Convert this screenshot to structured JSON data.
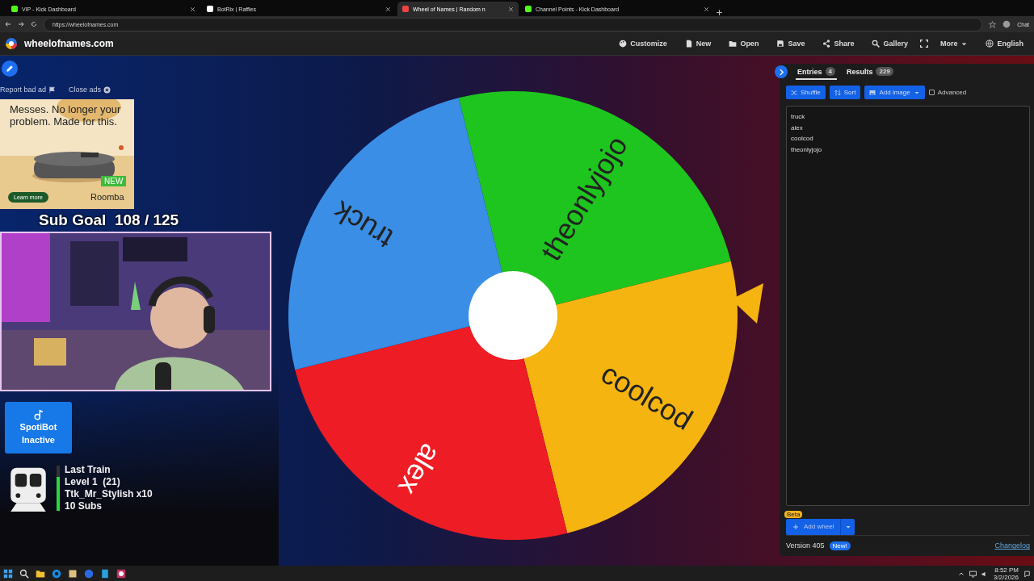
{
  "browser": {
    "tabs": [
      {
        "title": "VIP - Kick Dashboard",
        "selected": false
      },
      {
        "title": "BotRix | Raffles",
        "selected": false
      },
      {
        "title": "Wheel of Names | Random n",
        "selected": true
      },
      {
        "title": "Channel Points - Kick Dashboard",
        "selected": false
      }
    ],
    "address": "https://wheelofnames.com",
    "chat_label": "Chat"
  },
  "site": {
    "name": "wheelofnames.com",
    "nav": [
      "Customize",
      "New",
      "Open",
      "Save",
      "Share",
      "Gallery",
      "More",
      "English"
    ]
  },
  "ads": {
    "report": "Report bad ad",
    "close": "Close ads",
    "headline": "Messes. No longer your problem. Made for this.",
    "badge": "NEW",
    "cta": "Learn more",
    "brand": "Roomba"
  },
  "overlay": {
    "sub_goal": "Sub Goal  108 / 125",
    "spotibot": [
      "SpotiBot",
      "Inactive"
    ],
    "train": {
      "lines": [
        "Last Train",
        "Level 1  (21)",
        "Ttk_Mr_Stylish x10",
        "10 Subs"
      ],
      "level": 0.75
    }
  },
  "wheel": {
    "slices": [
      {
        "label": "theonlyjojo",
        "color": "#1ec51e"
      },
      {
        "label": "coolcod",
        "color": "#f5b40f"
      },
      {
        "label": "alex",
        "color": "#ee1c24"
      },
      {
        "label": "truck",
        "color": "#3a8ee6"
      }
    ]
  },
  "panel": {
    "tabs": [
      {
        "label": "Entries",
        "count": "4",
        "selected": true
      },
      {
        "label": "Results",
        "count": "229",
        "selected": false
      }
    ],
    "buttons": [
      "Shuffle",
      "Sort",
      "Add image"
    ],
    "advanced": {
      "label": "Advanced",
      "checked": false
    },
    "entries": [
      "truck",
      "alex",
      "coolcod",
      "theonlyjojo"
    ],
    "add_wheel": "Add wheel",
    "beta": "Beta",
    "version": "Version 405",
    "new_badge": "New!",
    "changelog": "Changelog"
  },
  "taskbar": {
    "time": "8:52 PM",
    "date": "3/2/2026"
  }
}
